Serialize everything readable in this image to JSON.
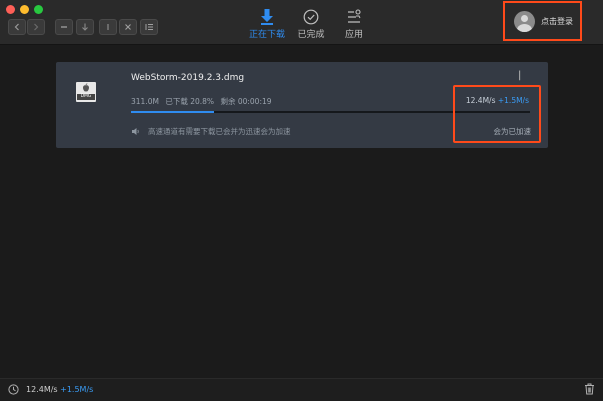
{
  "toolbar": {
    "tabs": [
      {
        "label": "正在下载",
        "icon": "download-arrow-icon",
        "active": true
      },
      {
        "label": "已完成",
        "icon": "check-circle-icon",
        "active": false
      },
      {
        "label": "应用",
        "icon": "apps-icon",
        "active": false
      }
    ],
    "login_label": "点击登录"
  },
  "task": {
    "file_name": "WebStorm-2019.2.3.dmg",
    "file_badge": "DMG",
    "size": "311.0M",
    "downloaded": "已下载 20.8%",
    "remaining": "剩余 00:00:19",
    "speed": "12.4M/s",
    "boost_speed": "+1.5M/s",
    "progress_fraction": 0.208,
    "hint": "高速通道有需要下载已会并为迅速会为加速",
    "boost_label": "会为已加速"
  },
  "statusbar": {
    "speed": "12.4M/s",
    "boost_speed": "+1.5M/s"
  },
  "colors": {
    "accent": "#2f8cf0",
    "highlight_box": "#ff4a1a",
    "card_bg": "#343a44"
  }
}
